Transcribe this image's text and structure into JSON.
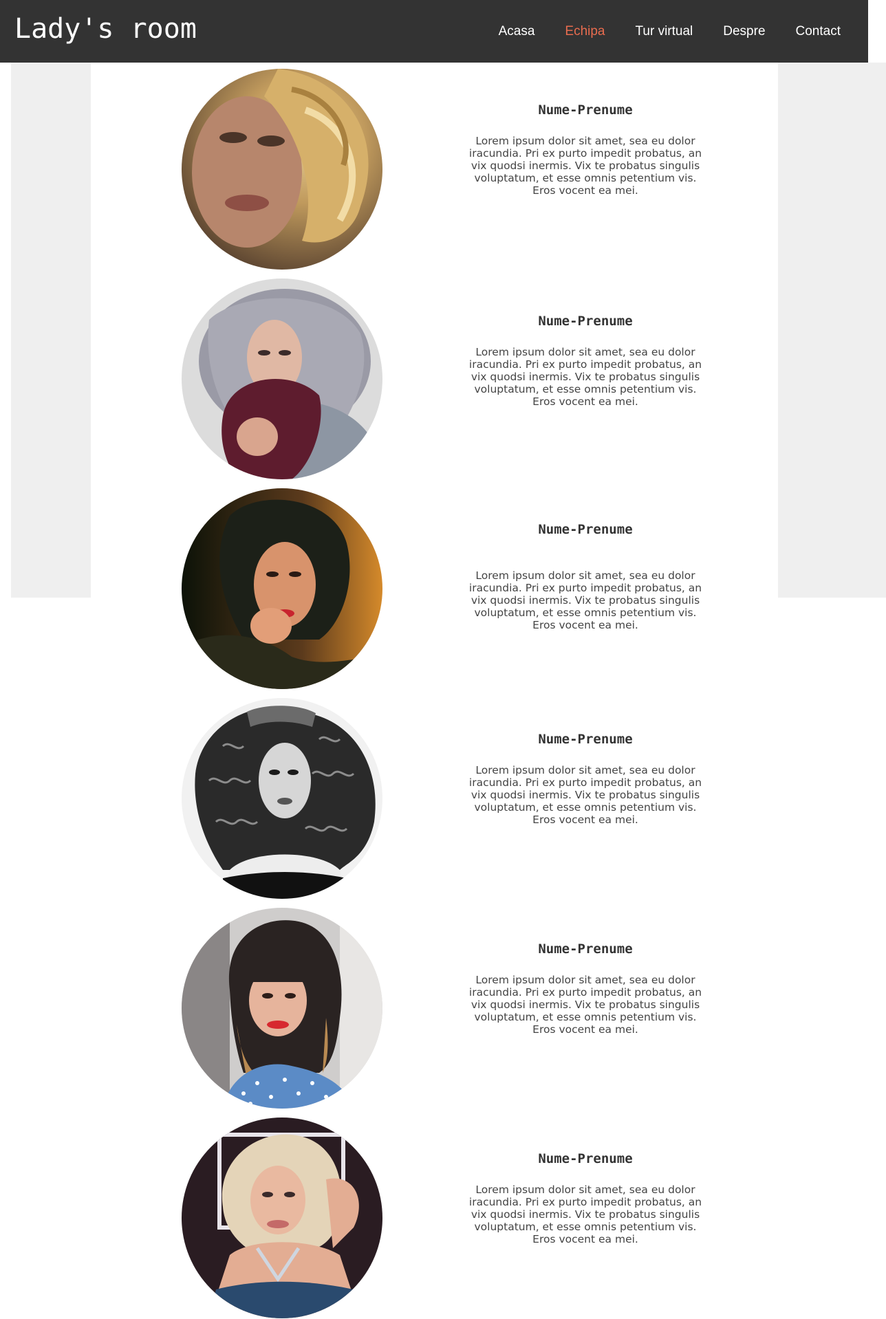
{
  "header": {
    "brand": "Lady's room",
    "nav": [
      {
        "label": "Acasa",
        "active": false
      },
      {
        "label": "Echipa",
        "active": true
      },
      {
        "label": "Tur virtual",
        "active": false
      },
      {
        "label": "Despre",
        "active": false
      },
      {
        "label": "Contact",
        "active": false
      }
    ],
    "colors": {
      "bar": "#333333",
      "active": "#e86c4f",
      "text": "#ffffff"
    }
  },
  "team": {
    "members": [
      {
        "name": "Nume-Prenume",
        "bio": "Lorem ipsum dolor sit amet, sea eu dolor iracundia. Pri ex purto impedit probatus, an vix quodsi inermis. Vix te probatus singulis voluptatum, et esse omnis petentium vis. Eros vocent ea mei.",
        "photo": "blonde-curly-portrait"
      },
      {
        "name": "Nume-Prenume",
        "bio": "Lorem ipsum dolor sit amet, sea eu dolor iracundia. Pri ex purto impedit probatus, an vix quodsi inermis. Vix te probatus singulis voluptatum, et esse omnis petentium vis. Eros vocent ea mei.",
        "photo": "silver-curly-hat-portrait"
      },
      {
        "name": "Nume-Prenume",
        "bio": "Lorem ipsum dolor sit amet, sea eu dolor iracundia. Pri ex purto impedit probatus, an vix quodsi inermis. Vix te probatus singulis voluptatum, et esse omnis petentium vis. Eros vocent ea mei.",
        "photo": "dark-hair-red-lips-portrait"
      },
      {
        "name": "Nume-Prenume",
        "bio": "Lorem ipsum dolor sit amet, sea eu dolor iracundia. Pri ex purto impedit probatus, an vix quodsi inermis. Vix te probatus singulis voluptatum, et esse omnis petentium vis. Eros vocent ea mei.",
        "photo": "black-white-curly-portrait"
      },
      {
        "name": "Nume-Prenume",
        "bio": "Lorem ipsum dolor sit amet, sea eu dolor iracundia. Pri ex purto impedit probatus, an vix quodsi inermis. Vix te probatus singulis voluptatum, et esse omnis petentium vis. Eros vocent ea mei.",
        "photo": "ombre-bangs-portrait"
      },
      {
        "name": "Nume-Prenume",
        "bio": "Lorem ipsum dolor sit amet, sea eu dolor iracundia. Pri ex purto impedit probatus, an vix quodsi inermis. Vix te probatus singulis voluptatum, et esse omnis petentium vis. Eros vocent ea mei.",
        "photo": "platinum-bob-portrait"
      }
    ]
  }
}
